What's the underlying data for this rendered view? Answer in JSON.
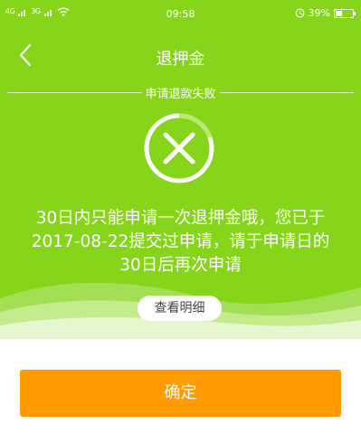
{
  "status_bar": {
    "signal_1": "4G",
    "signal_2": "3G",
    "time": "09:58",
    "battery_text": "39%",
    "battery_level": 0.39
  },
  "nav": {
    "title": "退押金",
    "back_icon": "chevron-left-icon"
  },
  "result": {
    "label": "申请退款失败",
    "icon": "close-circle-icon",
    "message_lines": [
      "30日内只能申请一次退押金哦，您已于",
      "2017-08-22提交过申请，请于申请日的",
      "30日后再次申请"
    ],
    "detail_button": "查看明细"
  },
  "footer": {
    "confirm_button": "确定"
  },
  "colors": {
    "hero_bg": "#86d51b",
    "accent": "#ff9a00"
  }
}
